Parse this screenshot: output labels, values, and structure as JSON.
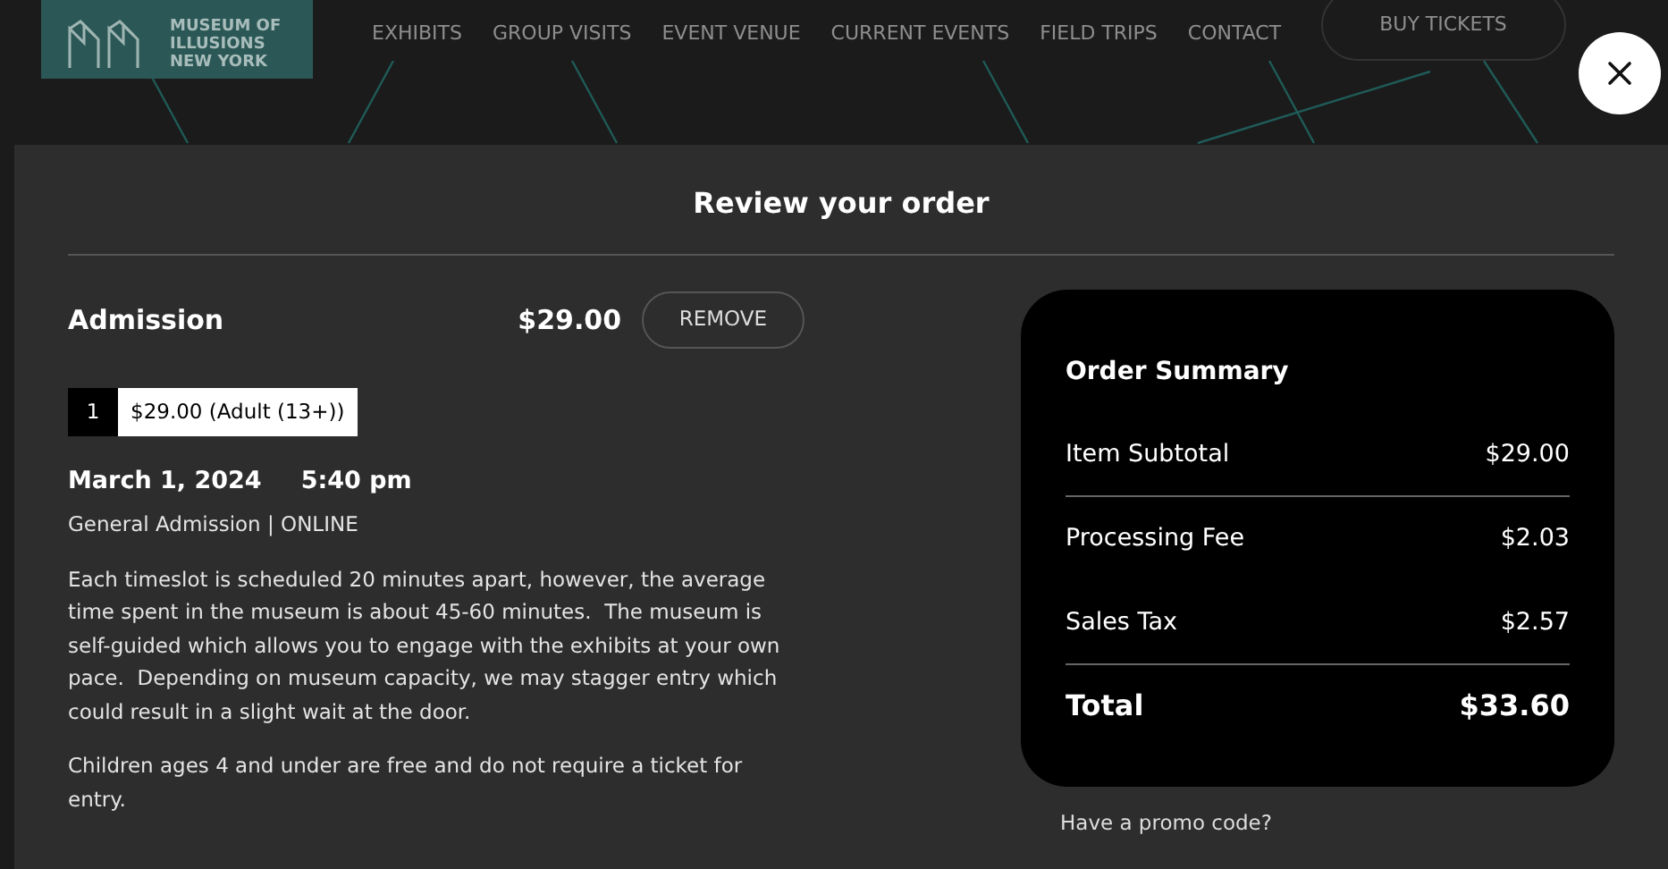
{
  "header": {
    "logo_lines": [
      "MUSEUM OF",
      "ILLUSIONS",
      "NEW YORK"
    ],
    "nav": [
      "EXHIBITS",
      "GROUP VISITS",
      "EVENT VENUE",
      "CURRENT EVENTS",
      "FIELD TRIPS",
      "CONTACT"
    ],
    "buy_button": "BUY TICKETS"
  },
  "modal": {
    "title": "Review your order",
    "item": {
      "name": "Admission",
      "price": "$29.00",
      "remove_button": "REMOVE",
      "quantity": "1",
      "ticket_label": "$29.00 (Adult (13+))",
      "date": "March 1, 2024",
      "time": "5:40 pm",
      "type_line": "General Admission | ONLINE",
      "description": [
        "Each timeslot is scheduled 20 minutes apart, however, the average time spent in the museum is about 45-60 minutes.  The museum is self-guided which allows you to engage with the exhibits at your own pace.  Depending on museum capacity, we may stagger entry which could result in a slight wait at the door.",
        "Children ages 4 and under are free and do not require a ticket for entry."
      ]
    },
    "summary": {
      "title": "Order Summary",
      "rows": [
        {
          "label": "Item Subtotal",
          "value": "$29.00",
          "divider_after": true
        },
        {
          "label": "Processing Fee",
          "value": "$2.03",
          "divider_after": false
        },
        {
          "label": "Sales Tax",
          "value": "$2.57",
          "divider_after": true
        }
      ],
      "total": {
        "label": "Total",
        "value": "$33.60"
      }
    },
    "promo_link": "Have a promo code?"
  }
}
